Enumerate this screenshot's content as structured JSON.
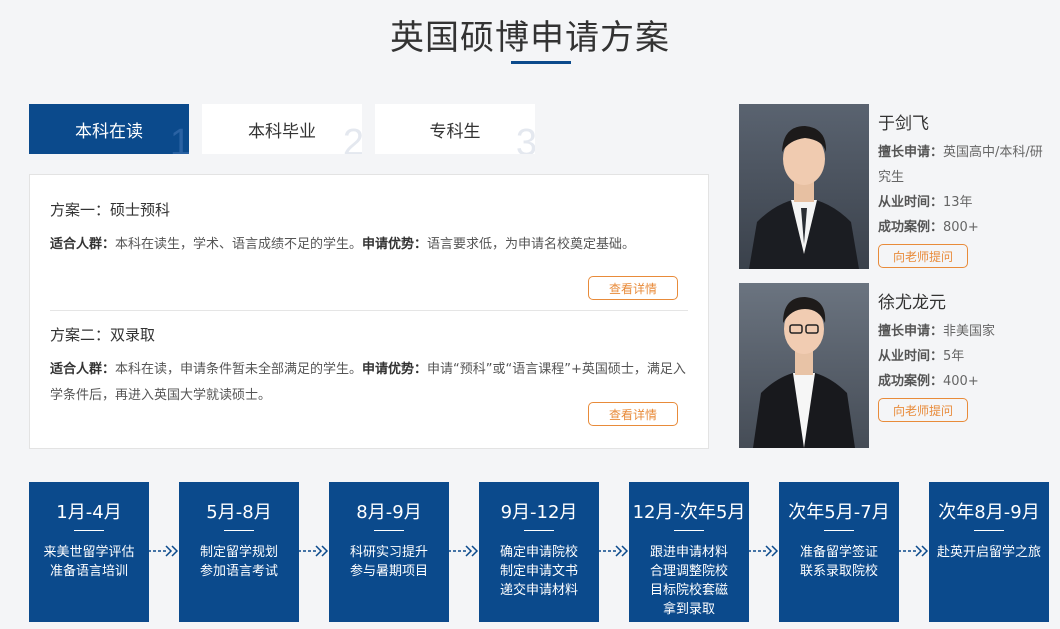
{
  "page": {
    "title": "英国硕博申请方案"
  },
  "tabs": [
    {
      "label": "本科在读",
      "num": "1"
    },
    {
      "label": "本科毕业",
      "num": "2"
    },
    {
      "label": "专科生",
      "num": "3"
    }
  ],
  "plans": [
    {
      "title": "方案一：硕士预科",
      "crowd_label": "适合人群：",
      "crowd": "本科在读生，学术、语言成绩不足的学生。",
      "adv_label": "申请优势：",
      "adv": "语言要求低，为申请名校奠定基础。",
      "button": "查看详情"
    },
    {
      "title": "方案二：双录取",
      "crowd_label": "适合人群：",
      "crowd": "本科在读，申请条件暂未全部满足的学生。",
      "adv_label": "申请优势：",
      "adv": "申请“预科”或“语言课程”+英国硕士，满足入学条件后，再进入英国大学就读硕士。",
      "button": "查看详情"
    }
  ],
  "teachers": [
    {
      "name": "于剑飞",
      "spec_label": "擅长申请：",
      "spec": "英国高中/本科/研究生",
      "years_label": "从业时间：",
      "years": "13年",
      "cases_label": "成功案例：",
      "cases": "800+",
      "button": "向老师提问"
    },
    {
      "name": "徐尤龙元",
      "spec_label": "擅长申请：",
      "spec": "非美国家",
      "years_label": "从业时间：",
      "years": "5年",
      "cases_label": "成功案例：",
      "cases": "400+",
      "button": "向老师提问"
    }
  ],
  "steps": [
    {
      "time": "1月-4月",
      "lines": [
        "来美世留学评估",
        "准备语言培训"
      ]
    },
    {
      "time": "5月-8月",
      "lines": [
        "制定留学规划",
        "参加语言考试"
      ]
    },
    {
      "time": "8月-9月",
      "lines": [
        "科研实习提升",
        "参与暑期项目"
      ]
    },
    {
      "time": "9月-12月",
      "lines": [
        "确定申请院校",
        "制定申请文书",
        "递交申请材料"
      ]
    },
    {
      "time": "12月-次年5月",
      "lines": [
        "跟进申请材料",
        "合理调整院校",
        "目标院校套磁",
        "拿到录取"
      ]
    },
    {
      "time": "次年5月-7月",
      "lines": [
        "准备留学签证",
        "联系录取院校"
      ]
    },
    {
      "time": "次年8月-9月",
      "lines": [
        "赴英开启留学之旅"
      ]
    }
  ],
  "colors": {
    "primary": "#0b4a8c",
    "accent": "#e88b3a",
    "background": "#f4f5f7"
  }
}
